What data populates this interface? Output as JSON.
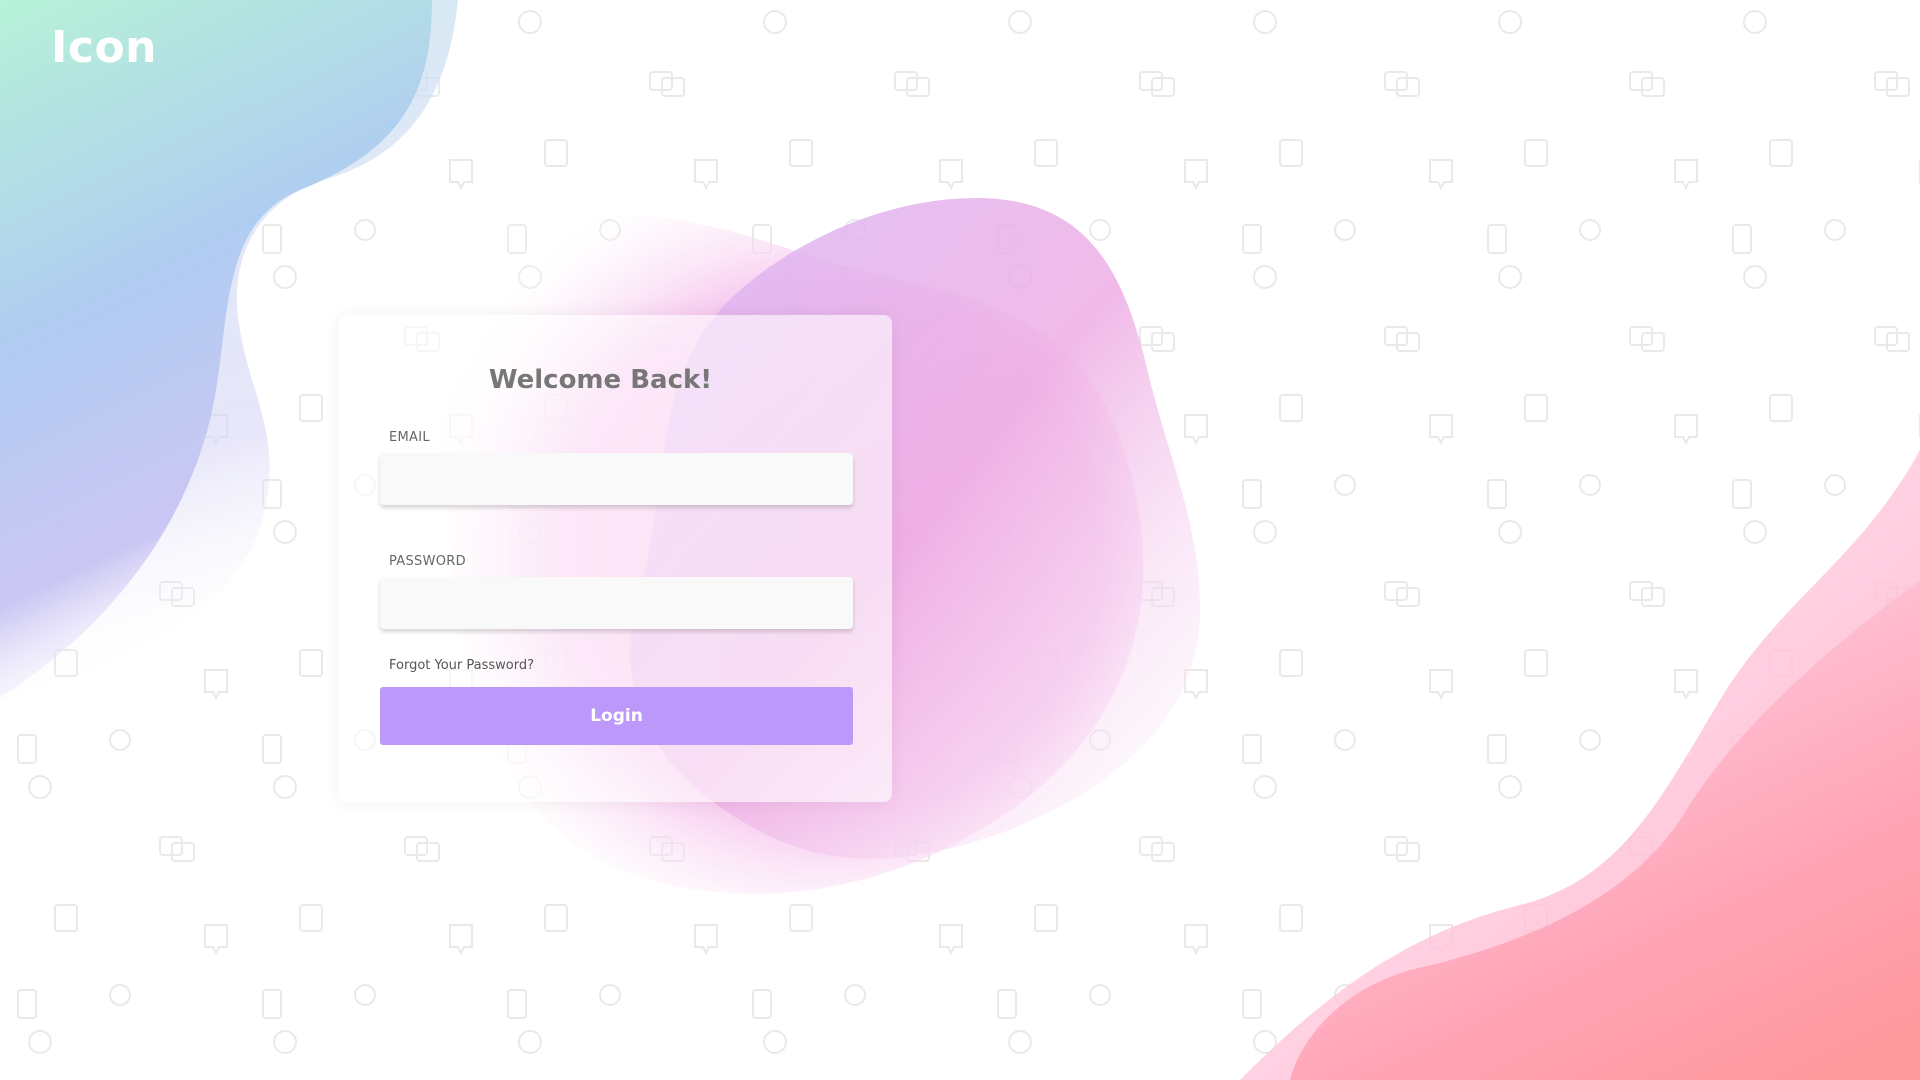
{
  "brand": {
    "logo_text": "Icon"
  },
  "login_card": {
    "title": "Welcome Back!",
    "email_label": "EMAIL",
    "email_value": "",
    "password_label": "PASSWORD",
    "password_value": "",
    "forgot_password_label": "Forgot Your Password?",
    "login_button_label": "Login"
  },
  "colors": {
    "accent": "#bd98fb",
    "background": "#ffffff",
    "title_text": "#777777",
    "blob_top_left_start": "#b8f2d6",
    "blob_top_left_end": "#c9c2f5",
    "blob_center": "#f3a8e6",
    "blob_bottom_right": "#ff9ea5"
  }
}
